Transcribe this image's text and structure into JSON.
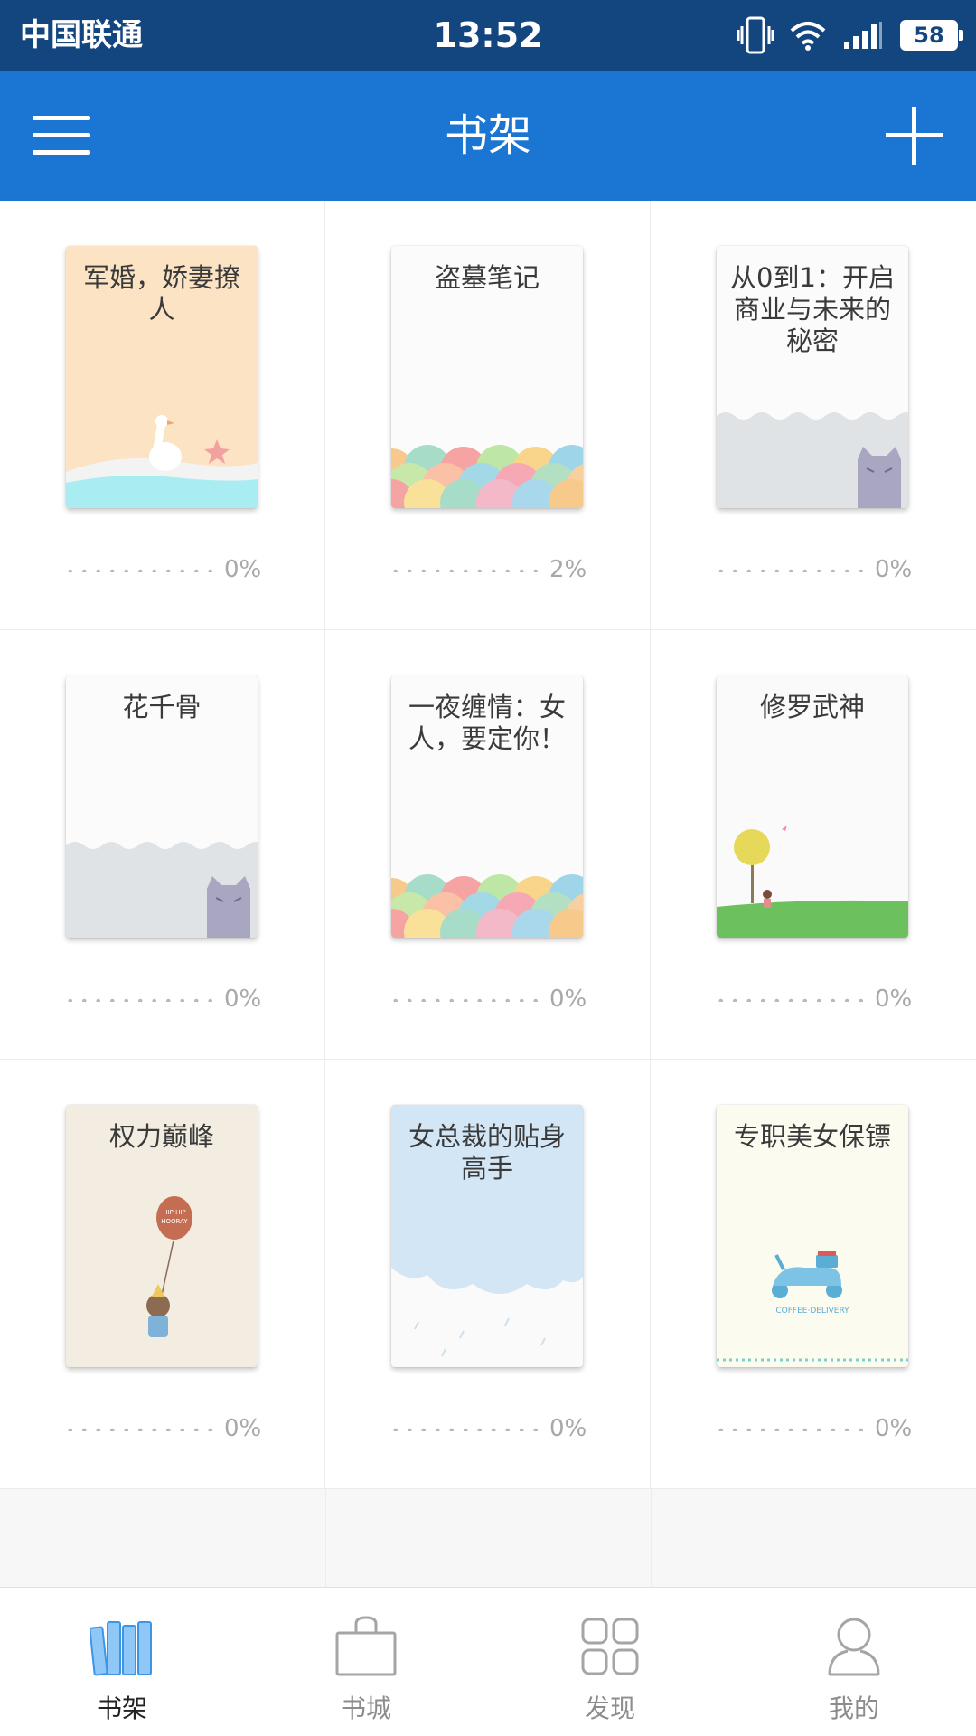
{
  "status_bar": {
    "carrier": "中国联通",
    "time": "13:52",
    "battery": "58"
  },
  "header": {
    "title": "书架",
    "menu_icon": "hamburger-menu-icon",
    "add_icon": "plus-icon"
  },
  "books": [
    {
      "title": "军婚，娇妻撩人",
      "progress": "0%",
      "theme": "goose-sea"
    },
    {
      "title": "盗墓笔记",
      "progress": "2%",
      "theme": "scales"
    },
    {
      "title": "从0到1：开启商业与未来的秘密",
      "progress": "0%",
      "theme": "cat-wave"
    },
    {
      "title": "花千骨",
      "progress": "0%",
      "theme": "cat-wave"
    },
    {
      "title": "一夜缠情：女人，要定你！",
      "progress": "0%",
      "theme": "scales"
    },
    {
      "title": "修罗武神",
      "progress": "0%",
      "theme": "girl-tree"
    },
    {
      "title": "权力巅峰",
      "progress": "0%",
      "theme": "bear-balloon"
    },
    {
      "title": "女总裁的贴身高手",
      "progress": "0%",
      "theme": "cloud-rain"
    },
    {
      "title": "专职美女保镖",
      "progress": "0%",
      "theme": "scooter"
    }
  ],
  "decor": {
    "balloon_text_1": "HIP HIP",
    "balloon_text_2": "HOORAY",
    "scooter_text": "COFFEE·DELIVERY"
  },
  "tabs": [
    {
      "label": "书架",
      "icon": "bookshelf-icon",
      "active": true
    },
    {
      "label": "书城",
      "icon": "shopping-bag-icon",
      "active": false
    },
    {
      "label": "发现",
      "icon": "grid-discover-icon",
      "active": false
    },
    {
      "label": "我的",
      "icon": "user-profile-icon",
      "active": false
    }
  ],
  "colors": {
    "status_bar": "#13467f",
    "app_bar": "#1a76d2",
    "active_tab": "#6cb4f5"
  }
}
